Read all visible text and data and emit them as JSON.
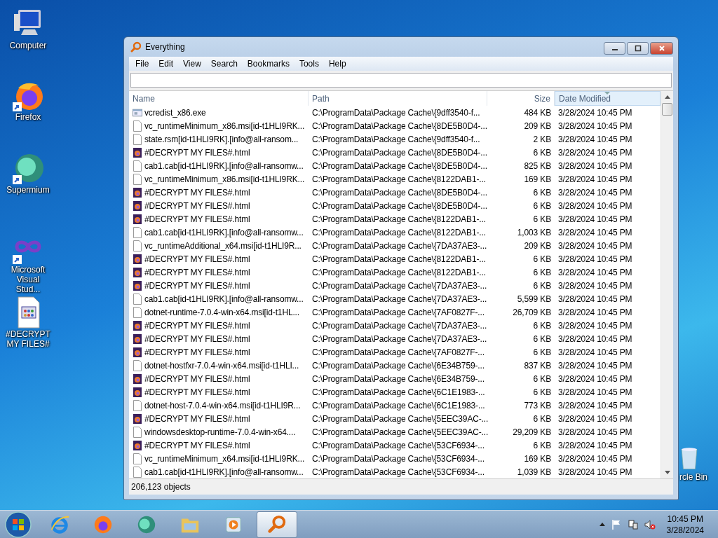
{
  "desktop_icons": [
    {
      "label": "Computer",
      "kind": "computer",
      "shortcut": false
    },
    {
      "label": "Firefox",
      "kind": "firefox",
      "shortcut": true
    },
    {
      "label": "Supermium",
      "kind": "supermium",
      "shortcut": true
    },
    {
      "label": "Microsoft Visual Stud...",
      "kind": "infinity",
      "shortcut": true
    },
    {
      "label": "#DECRYPT MY FILES#",
      "kind": "document",
      "shortcut": false
    },
    {
      "label": "rcle Bin",
      "kind": "bin",
      "shortcut": false
    }
  ],
  "window": {
    "title": "Everything"
  },
  "menu": [
    "File",
    "Edit",
    "View",
    "Search",
    "Bookmarks",
    "Tools",
    "Help"
  ],
  "table": {
    "columns": [
      {
        "label": "Name",
        "sorted": false
      },
      {
        "label": "Path",
        "sorted": false
      },
      {
        "label": "Size",
        "sorted": false
      },
      {
        "label": "Date Modified",
        "sorted": true
      }
    ],
    "rows": [
      {
        "kind": "exe",
        "name": "vcredist_x86.exe",
        "path": "C:\\ProgramData\\Package Cache\\{9dff3540-f...",
        "size": "484 KB",
        "modified": "3/28/2024 10:45 PM"
      },
      {
        "kind": "file",
        "name": "vc_runtimeMinimum_x86.msi[id-t1HLI9RK...",
        "path": "C:\\ProgramData\\Package Cache\\{8DE5B0D4-...",
        "size": "209 KB",
        "modified": "3/28/2024 10:45 PM"
      },
      {
        "kind": "file",
        "name": "state.rsm[id-t1HLI9RK].[info@all-ransom...",
        "path": "C:\\ProgramData\\Package Cache\\{9dff3540-f...",
        "size": "2 KB",
        "modified": "3/28/2024 10:45 PM"
      },
      {
        "kind": "html",
        "name": "#DECRYPT MY FILES#.html",
        "path": "C:\\ProgramData\\Package Cache\\{8DE5B0D4-...",
        "size": "6 KB",
        "modified": "3/28/2024 10:45 PM"
      },
      {
        "kind": "file",
        "name": "cab1.cab[id-t1HLI9RK].[info@all-ransomw...",
        "path": "C:\\ProgramData\\Package Cache\\{8DE5B0D4-...",
        "size": "825 KB",
        "modified": "3/28/2024 10:45 PM"
      },
      {
        "kind": "file",
        "name": "vc_runtimeMinimum_x86.msi[id-t1HLI9RK...",
        "path": "C:\\ProgramData\\Package Cache\\{8122DAB1-...",
        "size": "169 KB",
        "modified": "3/28/2024 10:45 PM"
      },
      {
        "kind": "html",
        "name": "#DECRYPT MY FILES#.html",
        "path": "C:\\ProgramData\\Package Cache\\{8DE5B0D4-...",
        "size": "6 KB",
        "modified": "3/28/2024 10:45 PM"
      },
      {
        "kind": "html",
        "name": "#DECRYPT MY FILES#.html",
        "path": "C:\\ProgramData\\Package Cache\\{8DE5B0D4-...",
        "size": "6 KB",
        "modified": "3/28/2024 10:45 PM"
      },
      {
        "kind": "html",
        "name": "#DECRYPT MY FILES#.html",
        "path": "C:\\ProgramData\\Package Cache\\{8122DAB1-...",
        "size": "6 KB",
        "modified": "3/28/2024 10:45 PM"
      },
      {
        "kind": "file",
        "name": "cab1.cab[id-t1HLI9RK].[info@all-ransomw...",
        "path": "C:\\ProgramData\\Package Cache\\{8122DAB1-...",
        "size": "1,003 KB",
        "modified": "3/28/2024 10:45 PM"
      },
      {
        "kind": "file",
        "name": "vc_runtimeAdditional_x64.msi[id-t1HLI9R...",
        "path": "C:\\ProgramData\\Package Cache\\{7DA37AE3-...",
        "size": "209 KB",
        "modified": "3/28/2024 10:45 PM"
      },
      {
        "kind": "html",
        "name": "#DECRYPT MY FILES#.html",
        "path": "C:\\ProgramData\\Package Cache\\{8122DAB1-...",
        "size": "6 KB",
        "modified": "3/28/2024 10:45 PM"
      },
      {
        "kind": "html",
        "name": "#DECRYPT MY FILES#.html",
        "path": "C:\\ProgramData\\Package Cache\\{8122DAB1-...",
        "size": "6 KB",
        "modified": "3/28/2024 10:45 PM"
      },
      {
        "kind": "html",
        "name": "#DECRYPT MY FILES#.html",
        "path": "C:\\ProgramData\\Package Cache\\{7DA37AE3-...",
        "size": "6 KB",
        "modified": "3/28/2024 10:45 PM"
      },
      {
        "kind": "file",
        "name": "cab1.cab[id-t1HLI9RK].[info@all-ransomw...",
        "path": "C:\\ProgramData\\Package Cache\\{7DA37AE3-...",
        "size": "5,599 KB",
        "modified": "3/28/2024 10:45 PM"
      },
      {
        "kind": "file",
        "name": "dotnet-runtime-7.0.4-win-x64.msi[id-t1HL...",
        "path": "C:\\ProgramData\\Package Cache\\{7AF0827F-...",
        "size": "26,709 KB",
        "modified": "3/28/2024 10:45 PM"
      },
      {
        "kind": "html",
        "name": "#DECRYPT MY FILES#.html",
        "path": "C:\\ProgramData\\Package Cache\\{7DA37AE3-...",
        "size": "6 KB",
        "modified": "3/28/2024 10:45 PM"
      },
      {
        "kind": "html",
        "name": "#DECRYPT MY FILES#.html",
        "path": "C:\\ProgramData\\Package Cache\\{7DA37AE3-...",
        "size": "6 KB",
        "modified": "3/28/2024 10:45 PM"
      },
      {
        "kind": "html",
        "name": "#DECRYPT MY FILES#.html",
        "path": "C:\\ProgramData\\Package Cache\\{7AF0827F-...",
        "size": "6 KB",
        "modified": "3/28/2024 10:45 PM"
      },
      {
        "kind": "file",
        "name": "dotnet-hostfxr-7.0.4-win-x64.msi[id-t1HLI...",
        "path": "C:\\ProgramData\\Package Cache\\{6E34B759-...",
        "size": "837 KB",
        "modified": "3/28/2024 10:45 PM"
      },
      {
        "kind": "html",
        "name": "#DECRYPT MY FILES#.html",
        "path": "C:\\ProgramData\\Package Cache\\{6E34B759-...",
        "size": "6 KB",
        "modified": "3/28/2024 10:45 PM"
      },
      {
        "kind": "html",
        "name": "#DECRYPT MY FILES#.html",
        "path": "C:\\ProgramData\\Package Cache\\{6C1E1983-...",
        "size": "6 KB",
        "modified": "3/28/2024 10:45 PM"
      },
      {
        "kind": "file",
        "name": "dotnet-host-7.0.4-win-x64.msi[id-t1HLI9R...",
        "path": "C:\\ProgramData\\Package Cache\\{6C1E1983-...",
        "size": "773 KB",
        "modified": "3/28/2024 10:45 PM"
      },
      {
        "kind": "html",
        "name": "#DECRYPT MY FILES#.html",
        "path": "C:\\ProgramData\\Package Cache\\{5EEC39AC-...",
        "size": "6 KB",
        "modified": "3/28/2024 10:45 PM"
      },
      {
        "kind": "file",
        "name": "windowsdesktop-runtime-7.0.4-win-x64....",
        "path": "C:\\ProgramData\\Package Cache\\{5EEC39AC-...",
        "size": "29,209 KB",
        "modified": "3/28/2024 10:45 PM"
      },
      {
        "kind": "html",
        "name": "#DECRYPT MY FILES#.html",
        "path": "C:\\ProgramData\\Package Cache\\{53CF6934-...",
        "size": "6 KB",
        "modified": "3/28/2024 10:45 PM"
      },
      {
        "kind": "file",
        "name": "vc_runtimeMinimum_x64.msi[id-t1HLI9RK...",
        "path": "C:\\ProgramData\\Package Cache\\{53CF6934-...",
        "size": "169 KB",
        "modified": "3/28/2024 10:45 PM"
      },
      {
        "kind": "file",
        "name": "cab1.cab[id-t1HLI9RK].[info@all-ransomw...",
        "path": "C:\\ProgramData\\Package Cache\\{53CF6934-...",
        "size": "1,039 KB",
        "modified": "3/28/2024 10:45 PM"
      }
    ]
  },
  "status_bar": "206,123 objects",
  "taskbar": {
    "items": [
      {
        "kind": "ie",
        "selected": false
      },
      {
        "kind": "firefox",
        "selected": false
      },
      {
        "kind": "supermium",
        "selected": false
      },
      {
        "kind": "folder",
        "selected": false
      },
      {
        "kind": "media",
        "selected": false
      },
      {
        "kind": "everything",
        "selected": true
      }
    ],
    "clock": {
      "time": "10:45 PM",
      "date": "3/28/2024"
    }
  }
}
